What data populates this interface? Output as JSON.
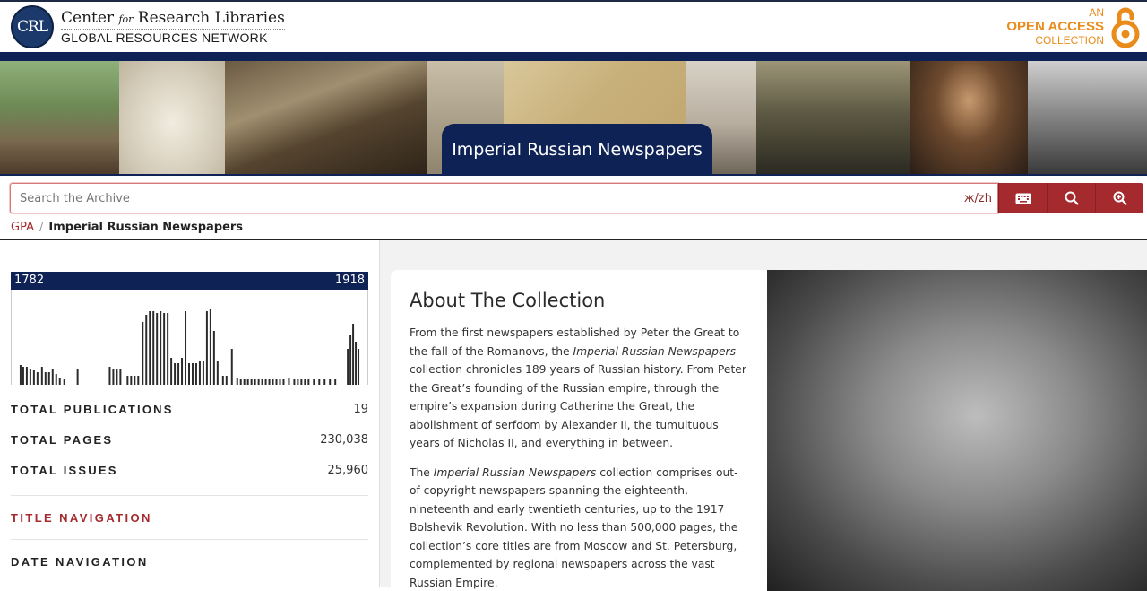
{
  "header": {
    "logo_mark": "CRL",
    "logo_line1_a": "Center ",
    "logo_line1_for": "for",
    "logo_line1_b": " Research Libraries",
    "logo_line2": "GLOBAL RESOURCES NETWORK",
    "oa_line1": "AN",
    "oa_line2": "OPEN ACCESS",
    "oa_line3": "COLLECTION",
    "accent": "#e98c1b",
    "navy": "#0e2256"
  },
  "banner": {
    "title": "Imperial Russian Newspapers"
  },
  "search": {
    "placeholder": "Search the Archive",
    "translit": "ж/zh",
    "buttons": [
      "keyboard-icon",
      "search-icon",
      "advanced-search-icon"
    ],
    "button_color": "#a52a2e"
  },
  "breadcrumb": {
    "root": "GPA",
    "sep": "/",
    "current": "Imperial Russian Newspapers"
  },
  "timeline": {
    "start": "1782",
    "end": "1918"
  },
  "stats": [
    {
      "label": "TOTAL PUBLICATIONS",
      "value": "19"
    },
    {
      "label": "TOTAL PAGES",
      "value": "230,038"
    },
    {
      "label": "TOTAL ISSUES",
      "value": "25,960"
    }
  ],
  "nav": {
    "title_nav": "TITLE NAVIGATION",
    "date_nav": "DATE NAVIGATION"
  },
  "about": {
    "heading": "About The Collection",
    "p1_a": "From the first newspapers established by Peter the Great to the fall of the Romanovs, the ",
    "p1_em": "Imperial Russian Newspapers",
    "p1_b": " collection chronicles 189 years of Russian history. From Peter the Great’s founding of the Russian empire, through the empire’s expansion during Catherine the Great, the abolishment of serfdom by Alexander II, the tumultuous years of Nicholas II, and everything in between.",
    "p2_a": "The ",
    "p2_em": "Imperial Russian Newspapers",
    "p2_b": " collection comprises out-of-copyright newspapers spanning the eighteenth, nineteenth and early twentieth centuries, up to the 1917 Bolshevik Revolution. With no less than 500,000 pages, the collection’s core titles are from Moscow and St. Petersburg, complemented by regional newspapers across the vast Russian Empire."
  }
}
